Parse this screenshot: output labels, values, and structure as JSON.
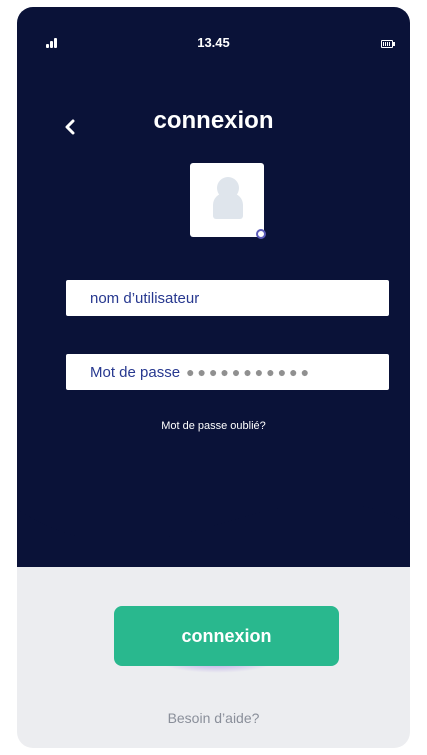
{
  "status_bar": {
    "time": "13.45",
    "signal_icon": "signal-bars-icon",
    "battery_icon": "battery-icon"
  },
  "header": {
    "title": "connexion",
    "back_icon": "chevron-left-icon"
  },
  "avatar": {
    "icon": "user-silhouette-icon",
    "badge": "edit-dot-icon"
  },
  "form": {
    "username_label": "nom d’utilisateur",
    "password_label": "Mot de passe",
    "password_mask": "●●●●●●●●●●●",
    "forgot_link": "Mot de passe oublié?"
  },
  "actions": {
    "login_button": "connexion",
    "help_link": "Besoin d’aide?"
  },
  "colors": {
    "header_bg": "#0a1238",
    "accent": "#29b88e",
    "field_text": "#27388f",
    "footer_bg": "#ecedf0"
  }
}
